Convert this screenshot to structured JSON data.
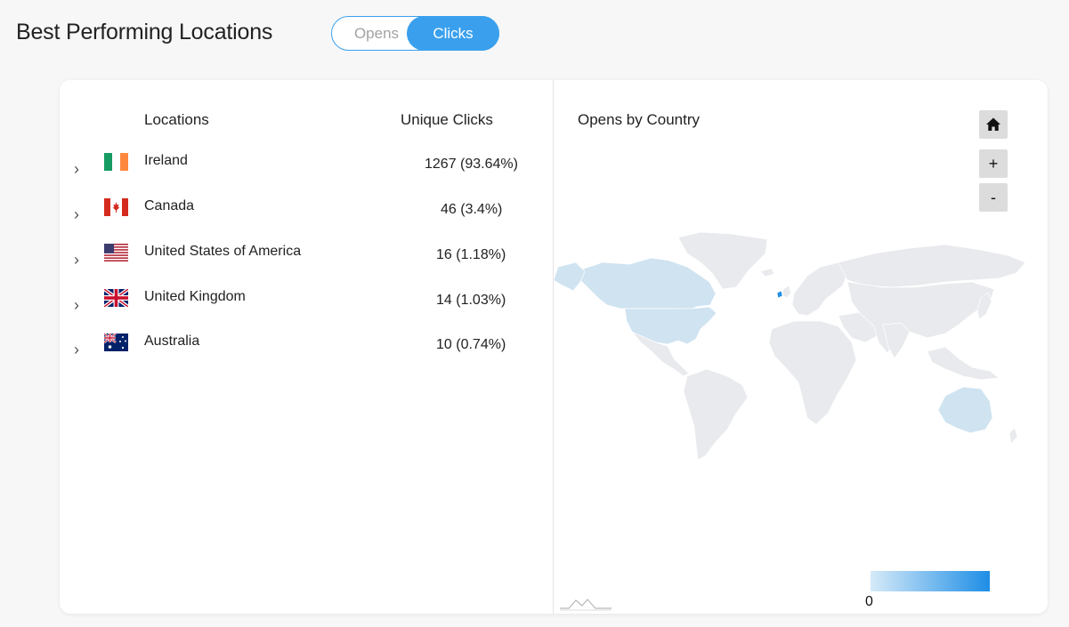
{
  "header": {
    "title": "Best Performing Locations",
    "toggle": {
      "opens_label": "Opens",
      "clicks_label": "Clicks",
      "selected": "Clicks"
    }
  },
  "table": {
    "headers": {
      "locations": "Locations",
      "metric": "Unique Clicks"
    },
    "rows": [
      {
        "flag": "ireland-flag-icon",
        "name": "Ireland",
        "value": "1267 (93.64%)"
      },
      {
        "flag": "canada-flag-icon",
        "name": "Canada",
        "value": "46 (3.4%)"
      },
      {
        "flag": "usa-flag-icon",
        "name": "United States of America",
        "value": "16 (1.18%)"
      },
      {
        "flag": "uk-flag-icon",
        "name": "United Kingdom",
        "value": "14 (1.03%)"
      },
      {
        "flag": "australia-flag-icon",
        "name": "Australia",
        "value": "10 (0.74%)"
      }
    ]
  },
  "map": {
    "title": "Opens by Country",
    "controls": {
      "home_icon": "home-icon",
      "zoom_in_label": "+",
      "zoom_out_label": "-"
    },
    "legend": {
      "min_label": "0",
      "color_low": "#d6eaf8",
      "color_high": "#1e8ee6"
    },
    "land_color": "#e8eaed",
    "highlight_color": "#cfe3f1",
    "accent_color": "#3aa0ee"
  }
}
